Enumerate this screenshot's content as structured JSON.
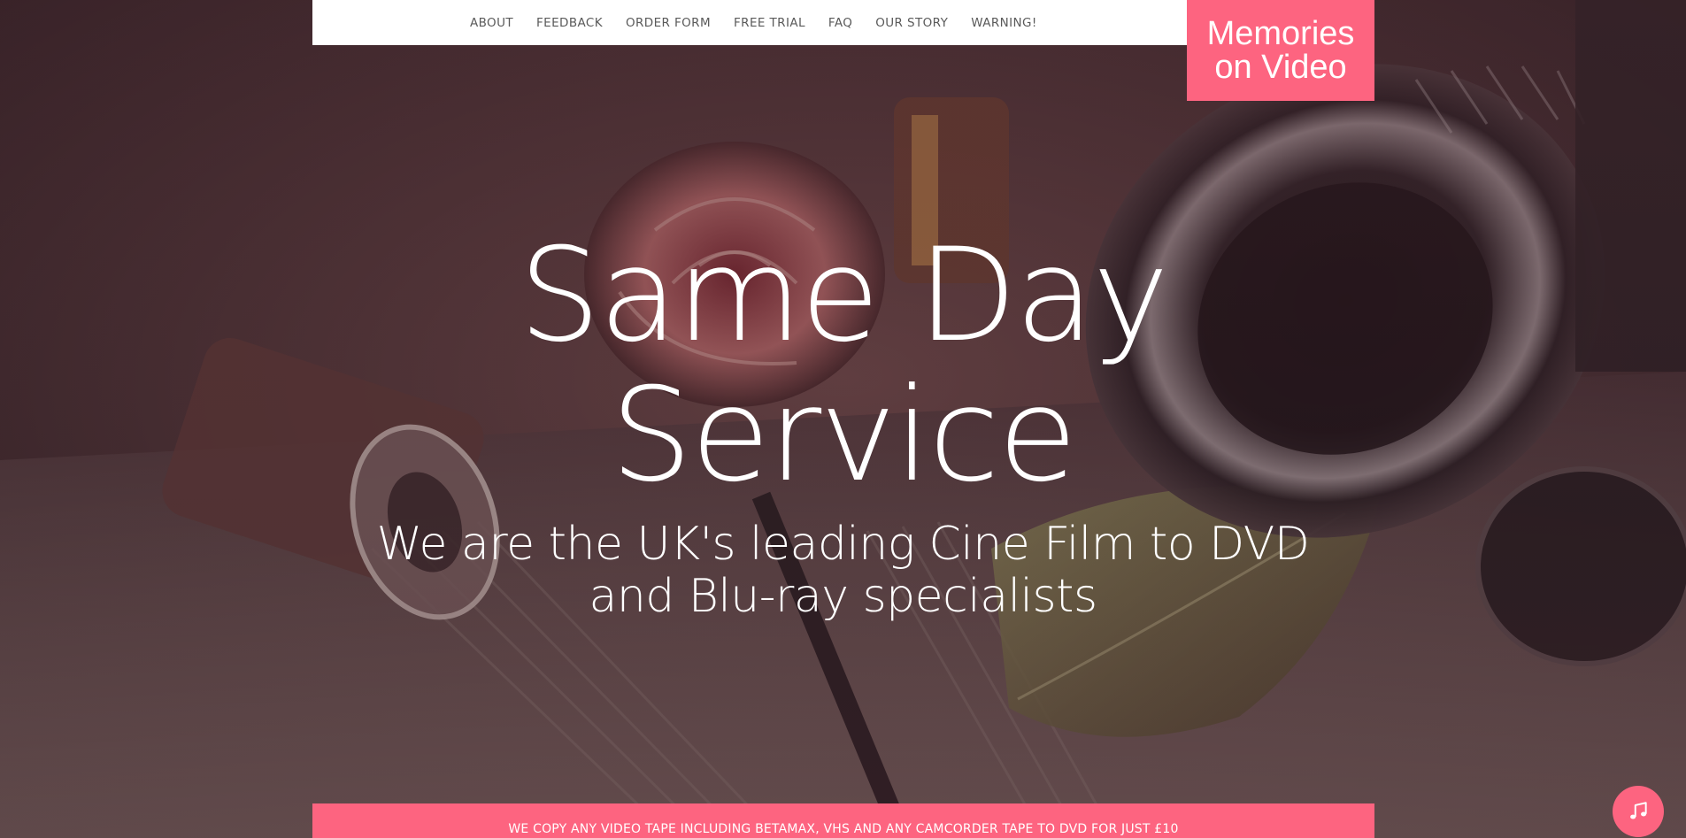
{
  "nav": {
    "items": [
      {
        "label": "ABOUT"
      },
      {
        "label": "FEEDBACK"
      },
      {
        "label": "ORDER FORM"
      },
      {
        "label": "FREE TRIAL"
      },
      {
        "label": "FAQ"
      },
      {
        "label": "OUR STORY"
      },
      {
        "label": "WARNING!"
      }
    ]
  },
  "brand": {
    "line1": "Memories",
    "line2": "on Video"
  },
  "hero": {
    "title_line1": "Same Day",
    "title_line2": "Service",
    "subtitle": "We are the UK's leading Cine Film to DVD and Blu-ray specialists"
  },
  "promo": {
    "text": "WE COPY ANY VIDEO TAPE INCLUDING BETAMAX, VHS AND ANY CAMCORDER TAPE TO DVD FOR JUST £10"
  },
  "music_button": {
    "icon": "music-note-icon"
  },
  "colors": {
    "accent": "#fd6480",
    "nav_bg": "#ffffff",
    "nav_text": "#5a5a5a",
    "hero_text": "#ffffff"
  }
}
